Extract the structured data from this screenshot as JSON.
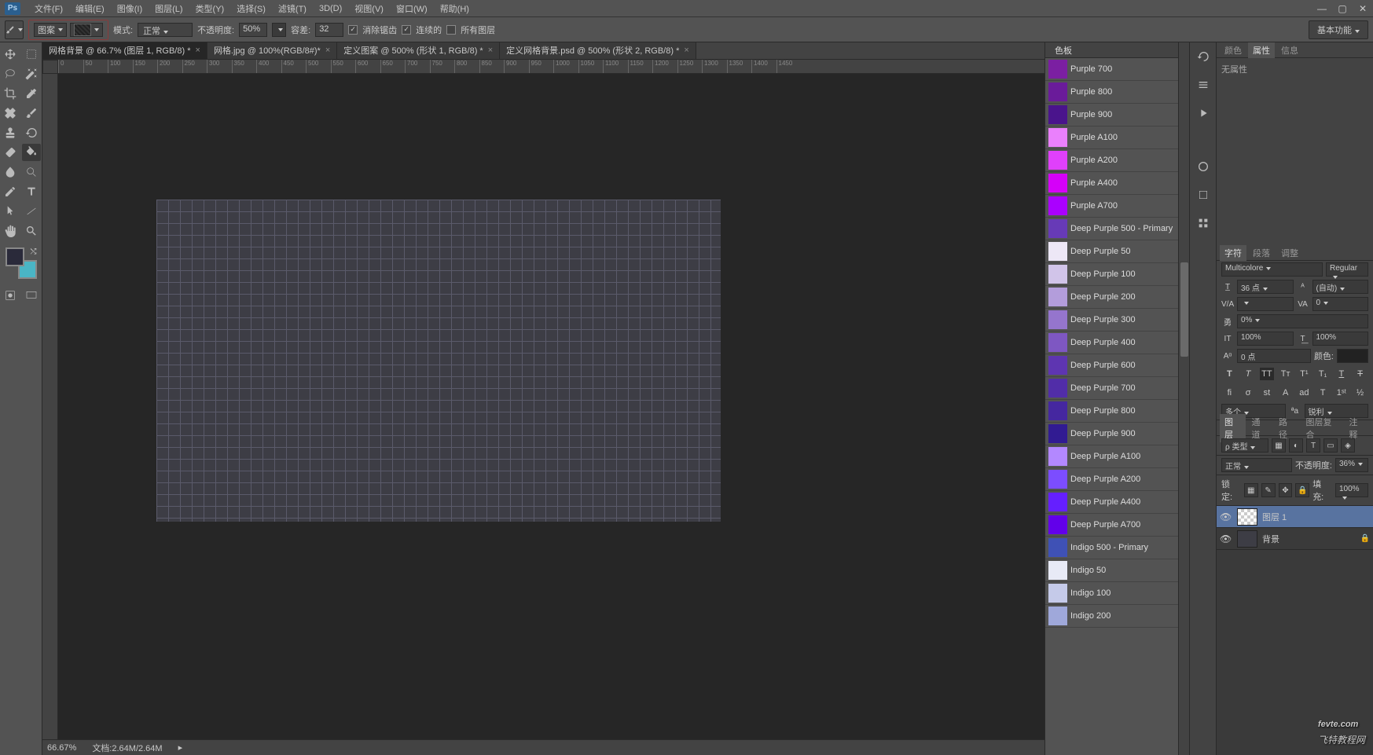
{
  "menubar": {
    "items": [
      "文件(F)",
      "编辑(E)",
      "图像(I)",
      "图层(L)",
      "类型(Y)",
      "选择(S)",
      "滤镜(T)",
      "3D(D)",
      "视图(V)",
      "窗口(W)",
      "帮助(H)"
    ]
  },
  "optionsbar": {
    "pattern_label": "图案",
    "mode_label": "模式:",
    "mode_value": "正常",
    "opacity_label": "不透明度:",
    "opacity_value": "50%",
    "tolerance_label": "容差:",
    "tolerance_value": "32",
    "antialias": "消除锯齿",
    "contiguous": "连续的",
    "all_layers": "所有图层",
    "workspace_btn": "基本功能"
  },
  "doc_tabs": [
    {
      "label": "网格背景 @ 66.7% (图层 1, RGB/8) *",
      "active": true
    },
    {
      "label": "网格.jpg @ 100%(RGB/8#)*",
      "active": false
    },
    {
      "label": "定义图案 @ 500% (形状 1, RGB/8) *",
      "active": false
    },
    {
      "label": "定义网格背景.psd @ 500% (形状 2, RGB/8) *",
      "active": false
    }
  ],
  "ruler_marks": [
    "0",
    "50",
    "100",
    "150",
    "200",
    "250",
    "300",
    "350",
    "400",
    "450",
    "500",
    "550",
    "600",
    "650",
    "700",
    "750",
    "800",
    "850",
    "900",
    "950",
    "1000",
    "1050",
    "1100",
    "1150",
    "1200",
    "1250",
    "1300",
    "1350",
    "1400",
    "1450"
  ],
  "statusbar": {
    "zoom": "66.67%",
    "doc_info": "文档:2.64M/2.64M"
  },
  "swatch_panel": {
    "title": "色板"
  },
  "swatches": [
    {
      "name": "Purple 700",
      "color": "#7B1FA2"
    },
    {
      "name": "Purple 800",
      "color": "#6A1B9A"
    },
    {
      "name": "Purple 900",
      "color": "#4A148C"
    },
    {
      "name": "Purple A100",
      "color": "#EA80FC"
    },
    {
      "name": "Purple A200",
      "color": "#E040FB"
    },
    {
      "name": "Purple A400",
      "color": "#D500F9"
    },
    {
      "name": "Purple A700",
      "color": "#AA00FF"
    },
    {
      "name": "Deep Purple 500 - Primary",
      "color": "#673AB7"
    },
    {
      "name": "Deep Purple 50",
      "color": "#EDE7F6"
    },
    {
      "name": "Deep Purple 100",
      "color": "#D1C4E9"
    },
    {
      "name": "Deep Purple 200",
      "color": "#B39DDB"
    },
    {
      "name": "Deep Purple 300",
      "color": "#9575CD"
    },
    {
      "name": "Deep Purple 400",
      "color": "#7E57C2"
    },
    {
      "name": "Deep Purple 600",
      "color": "#5E35B1"
    },
    {
      "name": "Deep Purple 700",
      "color": "#512DA8"
    },
    {
      "name": "Deep Purple 800",
      "color": "#4527A0"
    },
    {
      "name": "Deep Purple 900",
      "color": "#311B92"
    },
    {
      "name": "Deep Purple A100",
      "color": "#B388FF"
    },
    {
      "name": "Deep Purple A200",
      "color": "#7C4DFF"
    },
    {
      "name": "Deep Purple A400",
      "color": "#651FFF"
    },
    {
      "name": "Deep Purple A700",
      "color": "#6200EA"
    },
    {
      "name": "Indigo 500 - Primary",
      "color": "#3F51B5"
    },
    {
      "name": "Indigo 50",
      "color": "#E8EAF6"
    },
    {
      "name": "Indigo 100",
      "color": "#C5CAE9"
    },
    {
      "name": "Indigo 200",
      "color": "#9FA8DA"
    }
  ],
  "properties_panel": {
    "tabs": [
      "颜色",
      "属性",
      "信息"
    ],
    "active_tab": 1,
    "body": "无属性"
  },
  "char_panel": {
    "tabs": [
      "字符",
      "段落",
      "调整"
    ],
    "font": "Multicolore",
    "style": "Regular",
    "size": "36 点",
    "leading": "(自动)",
    "tracking": "0",
    "baseline_pct": "0%",
    "vscale": "100%",
    "hscale": "100%",
    "baseline": "0 点",
    "color_label": "颜色:",
    "aa_mode": "多个",
    "aa_sharp": "锐利"
  },
  "layers_panel": {
    "tabs": [
      "图层",
      "通道",
      "路径",
      "图层复合",
      "注释"
    ],
    "kind_label": "ρ 类型",
    "blend_mode": "正常",
    "opacity_label": "不透明度:",
    "opacity": "36%",
    "lock_label": "锁定:",
    "fill_label": "填充:",
    "fill": "100%",
    "layers": [
      {
        "name": "图层 1",
        "selected": true,
        "visible": true,
        "locked": false
      },
      {
        "name": "背景",
        "selected": false,
        "visible": true,
        "locked": true
      }
    ]
  },
  "watermark": {
    "brand": "fevte.com",
    "tagline": "飞特教程网"
  }
}
